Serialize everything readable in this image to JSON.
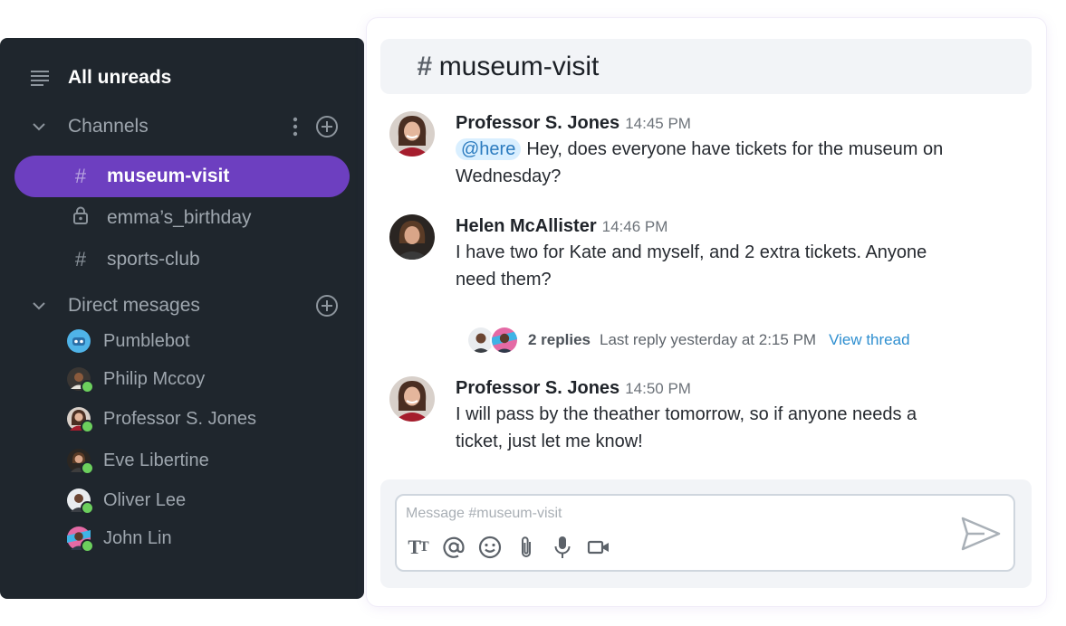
{
  "sidebar": {
    "all_unreads": "All unreads",
    "channels_label": "Channels",
    "channels": [
      {
        "name": "museum-visit",
        "icon": "hash-icon",
        "active": true
      },
      {
        "name": "emma’s_birthday",
        "icon": "lock-icon",
        "active": false
      },
      {
        "name": "sports-club",
        "icon": "hash-icon",
        "active": false
      }
    ],
    "dm_label": "Direct mesages",
    "dms": [
      {
        "name": "Pumblebot"
      },
      {
        "name": "Philip Mccoy"
      },
      {
        "name": "Professor S. Jones"
      },
      {
        "name": "Eve Libertine"
      },
      {
        "name": "Oliver Lee"
      },
      {
        "name": "John Lin"
      }
    ]
  },
  "chat": {
    "channel": "museum-visit",
    "messages": [
      {
        "author": "Professor S. Jones",
        "time": "14:45 PM",
        "mention": "@here",
        "text": "Hey, does everyone have tickets for the museum on Wednesday?"
      },
      {
        "author": "Helen McAllister",
        "time": "14:46 PM",
        "text": "I have two for Kate and myself, and 2 extra tickets. Anyone need them?"
      },
      {
        "author": "Professor S. Jones",
        "time": "14:50 PM",
        "text": "I will pass by the theather tomorrow, so if anyone needs a ticket, just let me know!"
      }
    ],
    "thread": {
      "replies": "2 replies",
      "last_reply": "Last reply yesterday at 2:15 PM",
      "link": "View thread"
    },
    "composer": {
      "placeholder": "Message #museum-visit"
    }
  },
  "colors": {
    "sidebar_bg": "#1f262d",
    "active_channel": "#6d3fc0",
    "presence": "#6ccf5d",
    "link": "#2f8fd0",
    "mention_bg": "#d9efff"
  }
}
